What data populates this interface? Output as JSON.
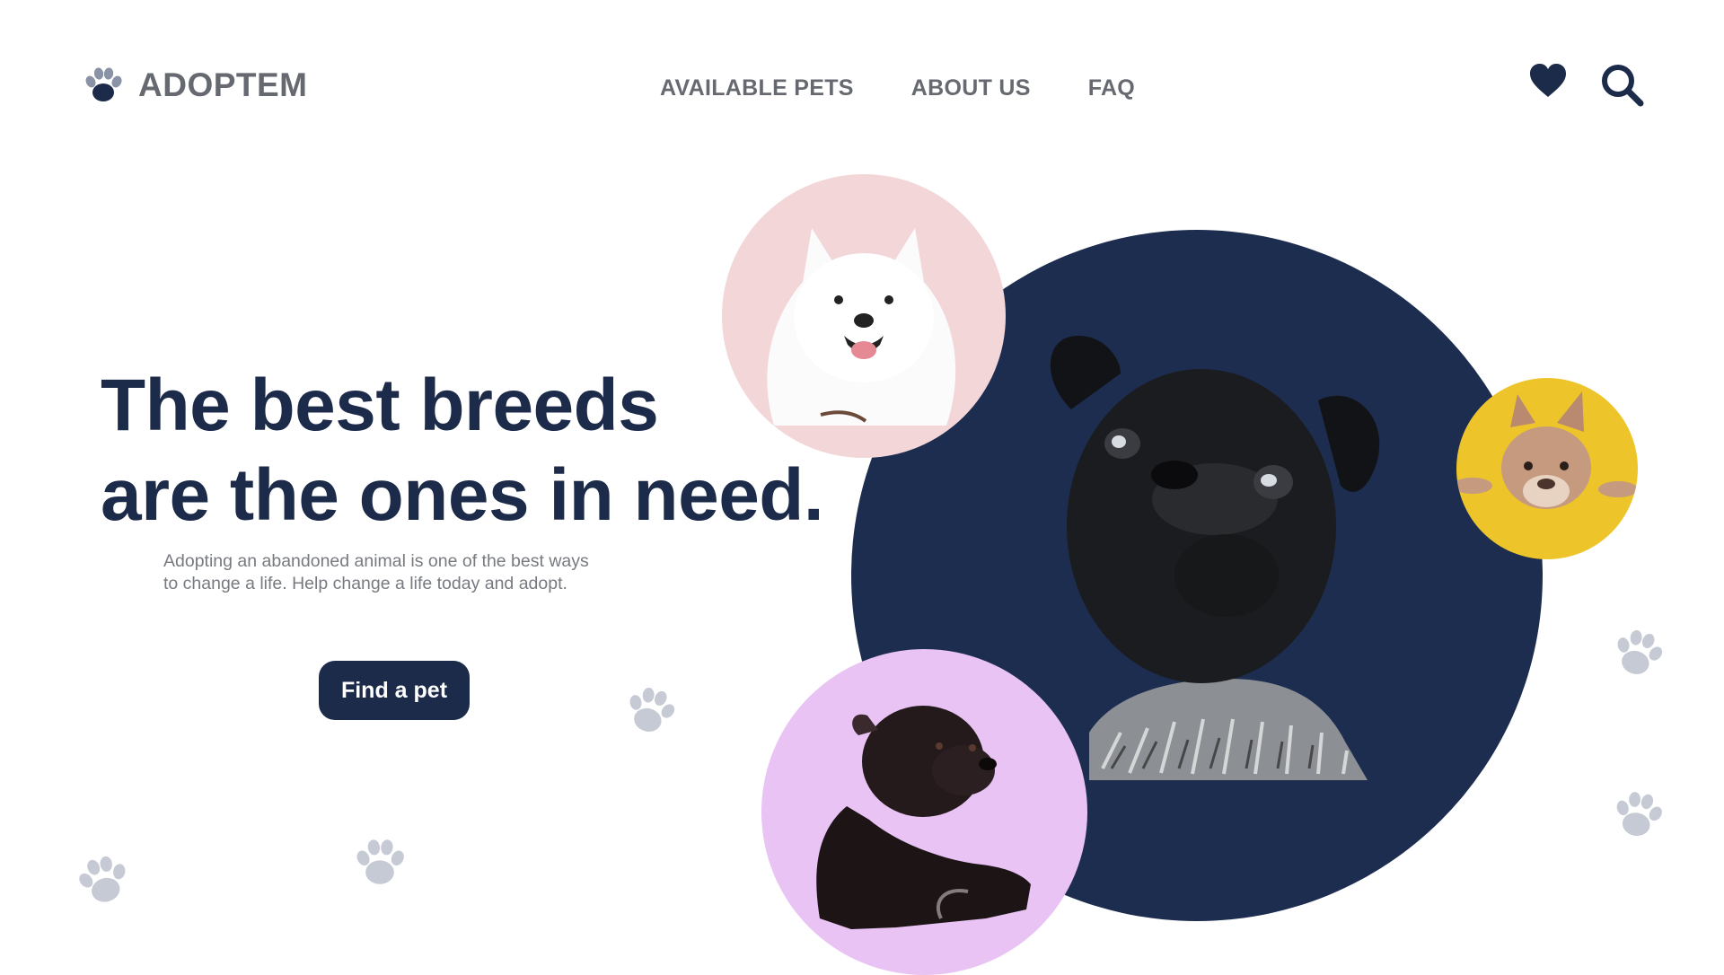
{
  "header": {
    "brand": "ADOPTEM",
    "nav": [
      {
        "label": "AVAILABLE PETS"
      },
      {
        "label": "ABOUT US"
      },
      {
        "label": "FAQ"
      }
    ],
    "icons": {
      "favorites": "heart-icon",
      "search": "search-icon",
      "logo": "paw-icon"
    }
  },
  "hero": {
    "headline_line1": "The best breeds",
    "headline_line2": "are the ones in need.",
    "subtitle_line1": "Adopting an abandoned animal is one of the best ways",
    "subtitle_line2": "to change a life. Help change a life today and adopt.",
    "cta": "Find a pet"
  },
  "pets": [
    {
      "name": "pug",
      "circle_color": "#1d2d4f"
    },
    {
      "name": "samoyed",
      "circle_color": "#f2d6d8"
    },
    {
      "name": "french-bulldog",
      "circle_color": "#eec42b"
    },
    {
      "name": "staffordshire-terrier",
      "circle_color": "#e8c3f4"
    }
  ],
  "colors": {
    "primary": "#1c2b4a",
    "nav_text": "#666a70",
    "paw_decor": "#c5cad4"
  }
}
